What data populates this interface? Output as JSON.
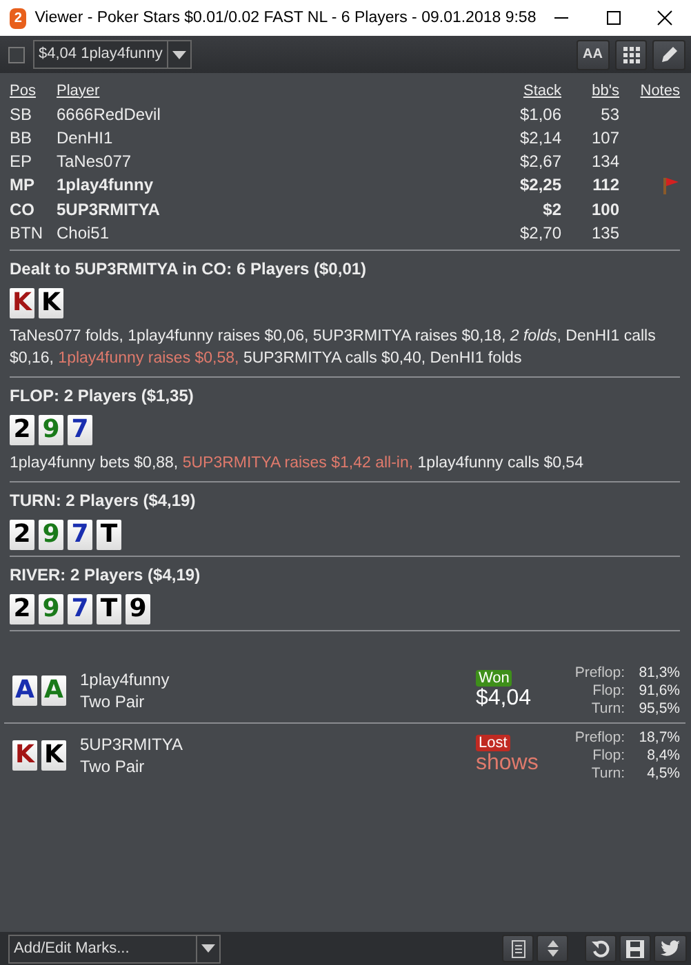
{
  "window": {
    "logo_text": "2",
    "title": "Viewer - Poker Stars $0.01/0.02 FAST NL - 6 Players - 09.01.2018 9:58"
  },
  "toolbar": {
    "checked": false,
    "hand_select": "$4,04 1play4funny",
    "font_button": "AA"
  },
  "table": {
    "columns": [
      "Pos",
      "Player",
      "Stack",
      "bb's",
      "Notes"
    ],
    "rows": [
      {
        "pos": "SB",
        "player": "6666RedDevil",
        "stack": "$1,06",
        "bbs": "53",
        "highlighted": false,
        "note": false
      },
      {
        "pos": "BB",
        "player": "DenHI1",
        "stack": "$2,14",
        "bbs": "107",
        "highlighted": false,
        "note": false
      },
      {
        "pos": "EP",
        "player": "TaNes077",
        "stack": "$2,67",
        "bbs": "134",
        "highlighted": false,
        "note": false
      },
      {
        "pos": "MP",
        "player": "1play4funny",
        "stack": "$2,25",
        "bbs": "112",
        "highlighted": true,
        "note": true
      },
      {
        "pos": "CO",
        "player": "5UP3RMITYA",
        "stack": "$2",
        "bbs": "100",
        "highlighted": true,
        "note": false
      },
      {
        "pos": "BTN",
        "player": "Choi51",
        "stack": "$2,70",
        "bbs": "135",
        "highlighted": false,
        "note": false
      }
    ]
  },
  "streets": [
    {
      "heading": "Dealt to 5UP3RMITYA in CO: 6 Players ($0,01)",
      "cards": [
        {
          "rank": "K",
          "color": "#a31515"
        },
        {
          "rank": "K",
          "color": "#000000"
        }
      ],
      "actions": [
        {
          "text": "TaNes077 folds, 1play4funny raises $0,06, 5UP3RMITYA raises $0,18, *2 folds*, DenHI1 calls $0,16, ",
          "highlight": false
        },
        {
          "text": "1play4funny raises $0,58, ",
          "highlight": true
        },
        {
          "text": "5UP3RMITYA calls $0,40, DenHI1 folds",
          "highlight": false
        }
      ]
    },
    {
      "heading": "FLOP: 2 Players ($1,35)",
      "cards": [
        {
          "rank": "2",
          "color": "#000000"
        },
        {
          "rank": "9",
          "color": "#1a7a1a"
        },
        {
          "rank": "7",
          "color": "#1a2fb0"
        }
      ],
      "actions": [
        {
          "text": "1play4funny bets $0,88, ",
          "highlight": false
        },
        {
          "text": "5UP3RMITYA raises $1,42 all-in, ",
          "highlight": true
        },
        {
          "text": "1play4funny calls $0,54",
          "highlight": false
        }
      ]
    },
    {
      "heading": "TURN: 2 Players ($4,19)",
      "cards": [
        {
          "rank": "2",
          "color": "#000000"
        },
        {
          "rank": "9",
          "color": "#1a7a1a"
        },
        {
          "rank": "7",
          "color": "#1a2fb0"
        },
        {
          "rank": "T",
          "color": "#000000"
        }
      ]
    },
    {
      "heading": "RIVER: 2 Players ($4,19)",
      "cards": [
        {
          "rank": "2",
          "color": "#000000"
        },
        {
          "rank": "9",
          "color": "#1a7a1a"
        },
        {
          "rank": "7",
          "color": "#1a2fb0"
        },
        {
          "rank": "T",
          "color": "#000000"
        },
        {
          "rank": "9",
          "color": "#000000"
        }
      ]
    }
  ],
  "results": [
    {
      "cards": [
        {
          "rank": "A",
          "color": "#1a2fb0"
        },
        {
          "rank": "A",
          "color": "#1a7a1a"
        }
      ],
      "player": "1play4funny",
      "hand": "Two Pair",
      "outcome": "Won",
      "kind": "won",
      "amount": "$4,04",
      "equity": [
        {
          "label": "Preflop:",
          "value": "81,3%"
        },
        {
          "label": "Flop:",
          "value": "91,6%"
        },
        {
          "label": "Turn:",
          "value": "95,5%"
        }
      ]
    },
    {
      "cards": [
        {
          "rank": "K",
          "color": "#a31515"
        },
        {
          "rank": "K",
          "color": "#000000"
        }
      ],
      "player": "5UP3RMITYA",
      "hand": "Two Pair",
      "outcome": "Lost",
      "kind": "lost",
      "amount": "shows",
      "equity": [
        {
          "label": "Preflop:",
          "value": "18,7%"
        },
        {
          "label": "Flop:",
          "value": "8,4%"
        },
        {
          "label": "Turn:",
          "value": "4,5%"
        }
      ]
    }
  ],
  "bottom": {
    "marks_select": "Add/Edit Marks..."
  }
}
